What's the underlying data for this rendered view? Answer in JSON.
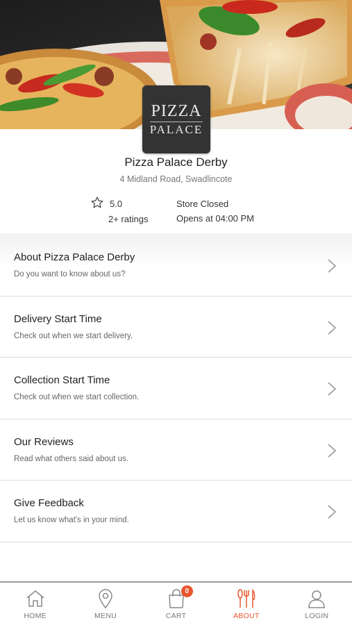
{
  "store": {
    "logo_line1": "PIZZA",
    "logo_line2": "PALACE",
    "name": "Pizza Palace Derby",
    "address": "4 Midland Road, Swadlincote",
    "rating": "5.0",
    "ratings_count": "2+ ratings",
    "status": "Store Closed",
    "opens": "Opens at 04:00 PM"
  },
  "menu": [
    {
      "title": "About Pizza Palace Derby",
      "subtitle": "Do you want to know about us?"
    },
    {
      "title": "Delivery Start Time",
      "subtitle": "Check out when we start delivery."
    },
    {
      "title": "Collection Start Time",
      "subtitle": "Check out when we start collection."
    },
    {
      "title": "Our Reviews",
      "subtitle": "Read what others said about us."
    },
    {
      "title": "Give Feedback",
      "subtitle": "Let us know what's in your mind."
    }
  ],
  "nav": {
    "items": [
      {
        "label": "HOME",
        "icon": "home-icon"
      },
      {
        "label": "MENU",
        "icon": "location-pin-icon"
      },
      {
        "label": "CART",
        "icon": "shopping-bag-icon"
      },
      {
        "label": "ABOUT",
        "icon": "fork-knife-icon"
      },
      {
        "label": "LOGIN",
        "icon": "user-icon"
      }
    ],
    "cart_count": "0",
    "active": "ABOUT"
  },
  "colors": {
    "accent": "#e8562d",
    "text": "#222222",
    "muted": "#777777",
    "divider": "#dcdcdc"
  }
}
